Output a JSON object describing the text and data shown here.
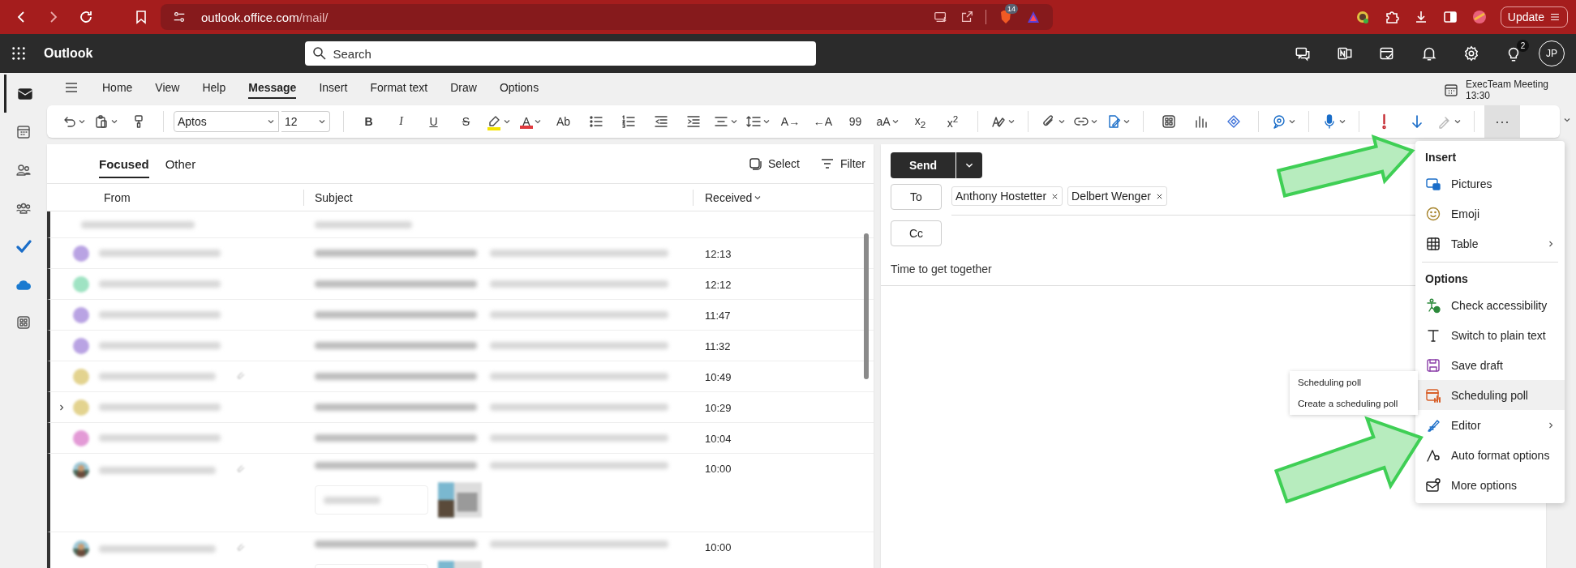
{
  "browser": {
    "url_host": "outlook.office.com",
    "url_path": "/mail/",
    "shield_badge": "14",
    "update_button": "Update"
  },
  "app_bar": {
    "title": "Outlook",
    "search_placeholder": "Search",
    "tips_badge": "2",
    "avatar_initials": "JP"
  },
  "rail": [
    {
      "selected": true
    },
    {
      "selected": false
    },
    {
      "selected": false
    },
    {
      "selected": false
    },
    {
      "selected": false
    },
    {
      "selected": false
    },
    {
      "selected": false
    }
  ],
  "ribbon_tabs": [
    {
      "label": "Home",
      "selected": false
    },
    {
      "label": "View",
      "selected": false
    },
    {
      "label": "Help",
      "selected": false
    },
    {
      "label": "Message",
      "selected": true
    },
    {
      "label": "Insert",
      "selected": false
    },
    {
      "label": "Format text",
      "selected": false
    },
    {
      "label": "Draw",
      "selected": false
    },
    {
      "label": "Options",
      "selected": false
    }
  ],
  "reminder": {
    "title": "ExecTeam Meeting",
    "time": "13:30"
  },
  "toolbar_groups": [
    [
      {
        "kind": "icon",
        "dropdown": true
      },
      {
        "kind": "icon",
        "dropdown": true
      },
      {
        "kind": "icon",
        "dropdown": false
      }
    ],
    [
      {
        "kind": "font",
        "value": "Aptos"
      },
      {
        "kind": "size",
        "value": "12"
      }
    ],
    [
      {
        "kind": "bold",
        "text": "B",
        "dropdown": false
      },
      {
        "kind": "italic",
        "text": "I",
        "dropdown": false
      },
      {
        "kind": "underline",
        "text": "U",
        "dropdown": false
      },
      {
        "kind": "strike",
        "text": "S",
        "dropdown": false
      },
      {
        "kind": "icon",
        "dropdown": true,
        "color": "#f5e400"
      },
      {
        "kind": "color",
        "text": "A",
        "dropdown": true,
        "color": "#e0393e"
      },
      {
        "kind": "text",
        "text": "Ab",
        "dropdown": false
      },
      {
        "kind": "icon",
        "dropdown": false
      },
      {
        "kind": "icon",
        "dropdown": false
      },
      {
        "kind": "icon",
        "dropdown": false
      },
      {
        "kind": "icon",
        "dropdown": false
      },
      {
        "kind": "icon",
        "dropdown": true
      },
      {
        "kind": "icon",
        "dropdown": true
      },
      {
        "kind": "text",
        "text": "A→",
        "dropdown": false
      },
      {
        "kind": "text",
        "text": "←A",
        "dropdown": false
      },
      {
        "kind": "text",
        "text": "99",
        "dropdown": false
      },
      {
        "kind": "text",
        "text": "aA",
        "dropdown": true
      },
      {
        "kind": "text",
        "text": "x$_{2}$",
        "dropdown": false
      },
      {
        "kind": "text",
        "text": "x$^{2}$",
        "dropdown": false
      }
    ],
    [
      {
        "kind": "icon",
        "dropdown": true
      }
    ],
    [
      {
        "kind": "icon",
        "dropdown": true
      },
      {
        "kind": "icon",
        "dropdown": true
      },
      {
        "kind": "icon",
        "dropdown": true
      }
    ],
    [
      {
        "kind": "icon",
        "dropdown": false
      },
      {
        "kind": "icon",
        "dropdown": false
      },
      {
        "kind": "icon",
        "dropdown": false
      }
    ],
    [
      {
        "kind": "icon",
        "dropdown": true
      }
    ],
    [
      {
        "kind": "icon",
        "dropdown": true
      }
    ],
    [
      {
        "kind": "icon",
        "dropdown": false
      },
      {
        "kind": "icon",
        "dropdown": false
      },
      {
        "kind": "icon",
        "dropdown": true,
        "disabled": true
      }
    ],
    [
      {
        "kind": "more",
        "text": "···",
        "dropdown": false,
        "selected": true
      }
    ]
  ],
  "list": {
    "tabs": [
      {
        "label": "Focused",
        "selected": true
      },
      {
        "label": "Other",
        "selected": false
      }
    ],
    "select_button": "Select",
    "filter_button": "Filter",
    "columns": [
      "From",
      "Subject",
      "Received"
    ],
    "rows": [
      {
        "kind": "summary",
        "time": null
      },
      {
        "kind": "mail",
        "color": "#b9a3e3",
        "time": "12:13",
        "attachment": false,
        "expand": false,
        "previews": false
      },
      {
        "kind": "mail",
        "color": "#9fe3c3",
        "time": "12:12",
        "attachment": false,
        "expand": false,
        "previews": false
      },
      {
        "kind": "mail",
        "color": "#b9a3e3",
        "time": "11:47",
        "attachment": false,
        "expand": false,
        "previews": false
      },
      {
        "kind": "mail",
        "color": "#b9a3e3",
        "time": "11:32",
        "attachment": false,
        "expand": false,
        "previews": false
      },
      {
        "kind": "mail",
        "color": "#e3d38f",
        "time": "10:49",
        "attachment": true,
        "expand": false,
        "previews": false
      },
      {
        "kind": "mail",
        "color": "#e3d38f",
        "time": "10:29",
        "attachment": false,
        "expand": true,
        "previews": false
      },
      {
        "kind": "mail",
        "color": "#e39ad6",
        "time": "10:04",
        "attachment": false,
        "expand": false,
        "previews": false
      },
      {
        "time": "10:00",
        "attachment": true,
        "expand": false,
        "previews": true
      },
      {
        "time": "10:00",
        "attachment": true,
        "expand": false,
        "previews": true
      }
    ]
  },
  "compose": {
    "send_button": "Send",
    "to_button": "To",
    "cc_button": "Cc",
    "recipients": [
      "Anthony Hostetter",
      "Delbert Wenger"
    ],
    "subject": "Time to get together"
  },
  "menu": {
    "sections": [
      {
        "heading": "Insert",
        "items": [
          {
            "label": "Pictures",
            "submenu": false,
            "selected": false
          },
          {
            "label": "Emoji",
            "submenu": false,
            "selected": false
          },
          {
            "label": "Table",
            "submenu": true,
            "selected": false
          }
        ]
      },
      {
        "heading": "Options",
        "items": [
          {
            "label": "Check accessibility",
            "submenu": false,
            "selected": false
          },
          {
            "label": "Switch to plain text",
            "submenu": false,
            "selected": false
          },
          {
            "label": "Save draft",
            "submenu": false,
            "selected": false
          },
          {
            "label": "Scheduling poll",
            "submenu": false,
            "selected": true
          },
          {
            "label": "Editor",
            "submenu": true,
            "selected": false
          },
          {
            "label": "Auto format options",
            "submenu": false,
            "selected": false
          },
          {
            "label": "More options",
            "submenu": false,
            "selected": false
          }
        ]
      }
    ]
  },
  "tooltip": {
    "title": "Scheduling poll",
    "description": "Create a scheduling poll"
  },
  "annotations": [
    {
      "kind": "arrow"
    },
    {
      "kind": "arrow"
    }
  ]
}
